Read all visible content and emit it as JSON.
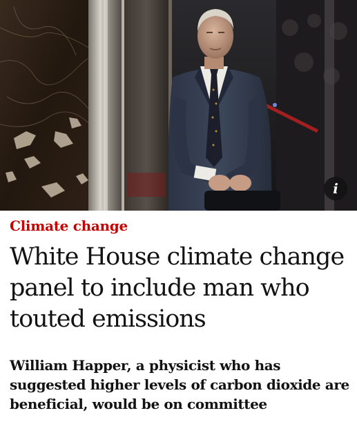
{
  "hero": {
    "info_icon": "info-icon",
    "info_glyph": "i"
  },
  "article": {
    "kicker": "Climate change",
    "headline": "White House climate change panel to include man who touted emissions",
    "standfirst": "William Happer, a physicist who has suggested higher levels of carbon dioxide are beneficial, would be on committee"
  },
  "colors": {
    "kicker": "#c70000",
    "text": "#121212",
    "background": "#ffffff"
  }
}
